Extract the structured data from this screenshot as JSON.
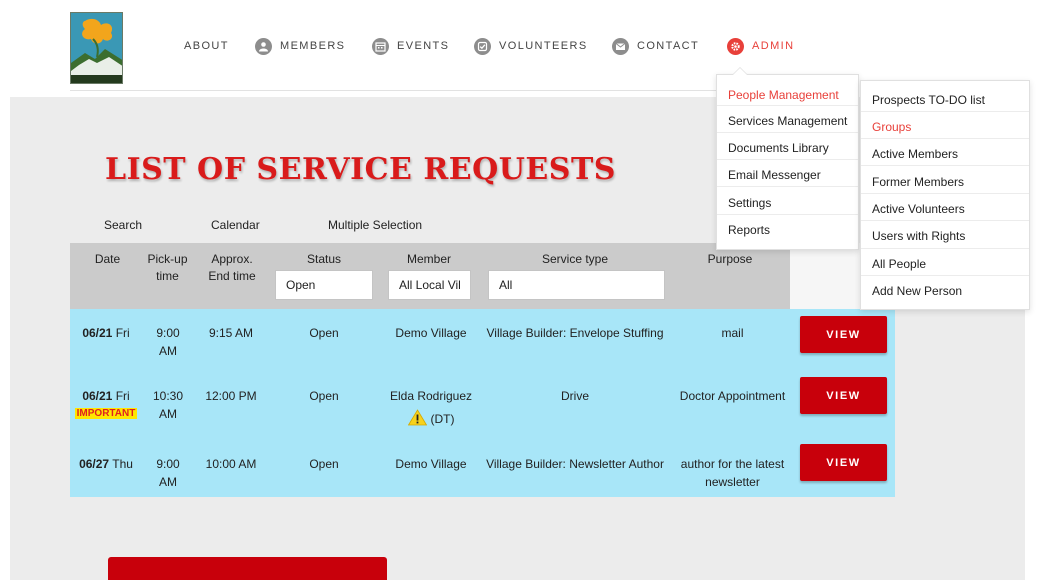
{
  "nav": {
    "items": [
      {
        "label": "ABOUT",
        "icon": ""
      },
      {
        "label": "MEMBERS",
        "icon": "person-icon"
      },
      {
        "label": "EVENTS",
        "icon": "calendar-icon"
      },
      {
        "label": "VOLUNTEERS",
        "icon": "check-icon"
      },
      {
        "label": "CONTACT",
        "icon": "envelope-icon"
      },
      {
        "label": "ADMIN",
        "icon": "gear-icon"
      }
    ],
    "active": "ADMIN",
    "accent_color": "#e8403a"
  },
  "page": {
    "title": "LIST OF SERVICE REQUESTS",
    "title_color": "#d91b1b"
  },
  "subnav": {
    "search": "Search",
    "calendar": "Calendar",
    "multiple": "Multiple Selection"
  },
  "table": {
    "headers": {
      "date": "Date",
      "pickup": "Pick-up time",
      "end": "Approx. End time",
      "status": "Status",
      "member": "Member",
      "service": "Service type",
      "purpose": "Purpose"
    },
    "filters": {
      "status": "Open",
      "member": "All Local Vil",
      "service": "All"
    },
    "rows": [
      {
        "date": "06/21",
        "day": "Fri",
        "important": "",
        "pickup": "9:00 AM",
        "end": "9:15 AM",
        "status": "Open",
        "member": "Demo Village",
        "member_note": "",
        "service": "Village Builder: Envelope Stuffing",
        "purpose": "mail",
        "action": "VIEW"
      },
      {
        "date": "06/21",
        "day": "Fri",
        "important": "IMPORTANT",
        "pickup": "10:30 AM",
        "end": "12:00 PM",
        "status": "Open",
        "member": "Elda Rodriguez",
        "member_note": "(DT)",
        "service": "Drive",
        "purpose": "Doctor Appointment",
        "action": "VIEW"
      },
      {
        "date": "06/27",
        "day": "Thu",
        "important": "",
        "pickup": "9:00 AM",
        "end": "10:00 AM",
        "status": "Open",
        "member": "Demo Village",
        "member_note": "",
        "service": "Village Builder: Newsletter Author",
        "purpose": "author for the latest newsletter",
        "action": "VIEW"
      }
    ],
    "row_color": "#a8e6f8",
    "button_color": "#c8000b"
  },
  "admin_menu": {
    "items": [
      "People Management",
      "Services Management",
      "Documents Library",
      "Email Messenger",
      "Settings",
      "Reports"
    ],
    "highlighted": "People Management"
  },
  "people_submenu": {
    "items": [
      "Prospects TO-DO list",
      "Groups",
      "Active Members",
      "Former Members",
      "Active Volunteers",
      "Users with Rights",
      "All People",
      "Add New Person"
    ],
    "highlighted": "Groups"
  }
}
